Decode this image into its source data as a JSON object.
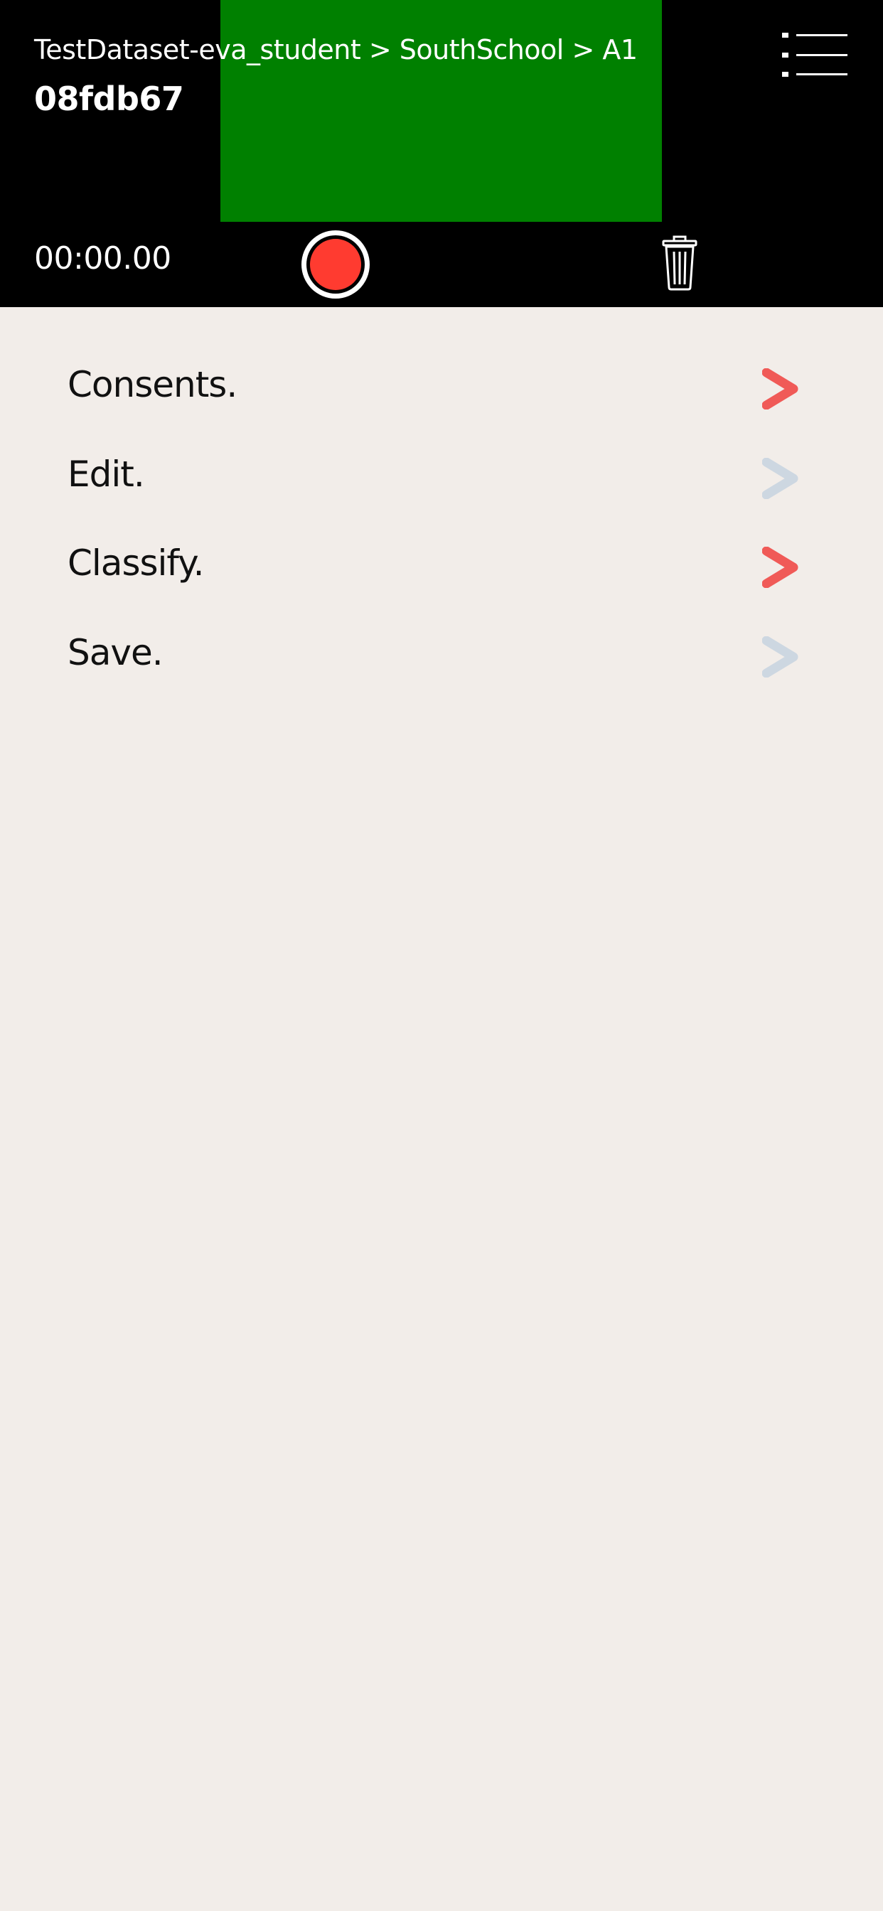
{
  "header": {
    "breadcrumb": "TestDataset-eva_student > SouthSchool > A1",
    "recording_id": "08fdb67",
    "timer": "00:00.00",
    "preview_color": "#008000",
    "menu_icon": "list-menu-icon",
    "record_icon": "record-icon",
    "record_color": "#FF3B30",
    "trash_icon": "trash-icon"
  },
  "steps": [
    {
      "label": "Consents.",
      "arrow_state": "active",
      "arrow_color": "#F05A57"
    },
    {
      "label": "Edit.",
      "arrow_state": "inactive",
      "arrow_color": "#CDD7E1"
    },
    {
      "label": "Classify.",
      "arrow_state": "active",
      "arrow_color": "#F05A57"
    },
    {
      "label": "Save.",
      "arrow_state": "inactive",
      "arrow_color": "#CDD7E1"
    }
  ],
  "colors": {
    "background": "#F2EDE9",
    "header_background": "#000000",
    "accent_red": "#F05A57",
    "inactive_gray": "#CDD7E1"
  }
}
